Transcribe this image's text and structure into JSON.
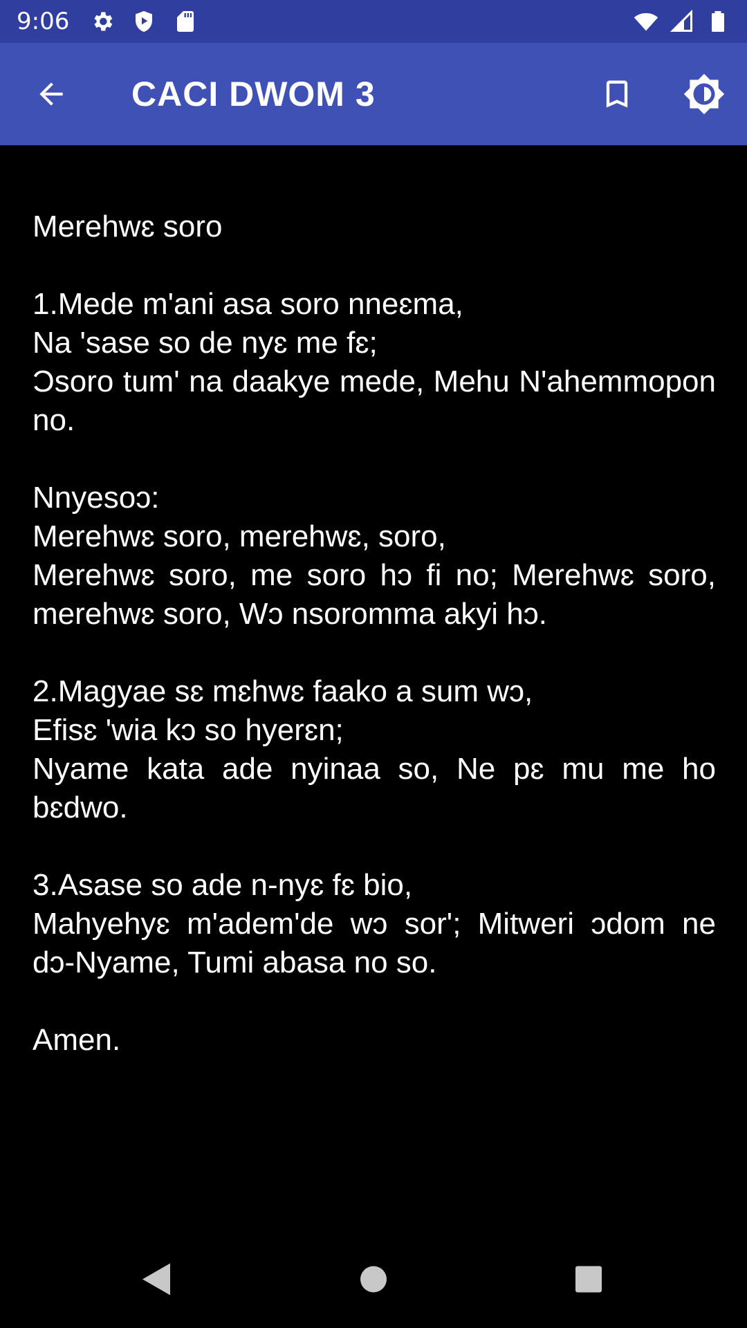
{
  "status_bar": {
    "time": "9:06",
    "left_icons": [
      "gear-icon",
      "play-protect-icon",
      "sd-card-icon"
    ],
    "right_icons": [
      "wifi-icon",
      "signal-icon",
      "battery-icon"
    ]
  },
  "app_bar": {
    "title": "CACI DWOM 3",
    "back_icon": "arrow-back-icon",
    "bookmark_icon": "bookmark-icon",
    "brightness_icon": "brightness-icon",
    "color": "#3F51B5",
    "status_color": "#303F9F"
  },
  "hymn": {
    "heading": "Merehwɛ soro",
    "verse1": {
      "line1": "1.Mede m'ani asa soro nneɛma,",
      "line2": "Na 'sase so de nyɛ me fɛ;",
      "line3": "Ɔsoro tum' na daakye mede, Mehu N'ahemmopon no."
    },
    "chorus": {
      "label": "Nnyesoɔ:",
      "line1": "Merehwɛ soro, merehwɛ, soro,",
      "line2": "Merehwɛ soro, me soro hɔ fi no; Merehwɛ soro, merehwɛ soro, Wɔ nsoromma akyi hɔ."
    },
    "verse2": {
      "line1": "2.Magyae sɛ mɛhwɛ faako a sum wɔ,",
      "line2": "Efisɛ 'wia kɔ so hyerɛn;",
      "line3": "Nyame kata ade nyinaa so, Ne pɛ mu me ho bɛdwo."
    },
    "verse3": {
      "line1": "3.Asase so ade n-nyɛ fɛ bio,",
      "line2": "Mahyehyɛ m'adem'de wɔ sor'; Mitweri ɔdom ne dɔ-Nyame, Tumi abasa no so."
    },
    "ending": "Amen."
  },
  "nav_bar": {
    "back_icon": "nav-back-icon",
    "home_icon": "nav-home-icon",
    "recents_icon": "nav-recents-icon"
  }
}
